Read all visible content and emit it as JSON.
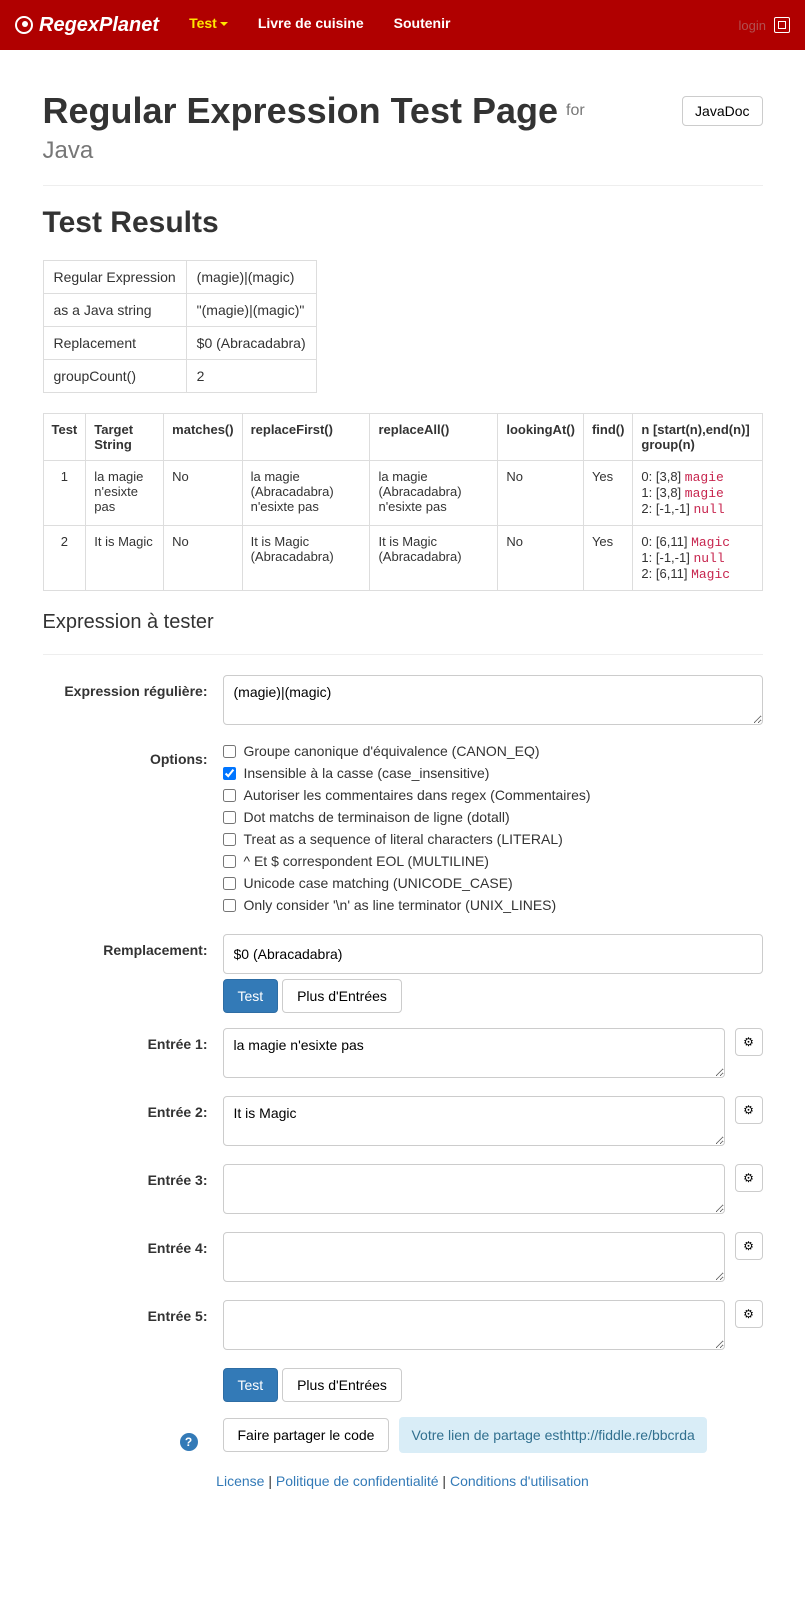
{
  "nav": {
    "brand": "RegexPlanet",
    "items": [
      {
        "label": "Test",
        "active": true
      },
      {
        "label": "Livre de cuisine",
        "active": false
      },
      {
        "label": "Soutenir",
        "active": false
      }
    ],
    "login": "login"
  },
  "header": {
    "title": "Regular Expression Test Page",
    "for": "for",
    "language": "Java",
    "javadoc_btn": "JavaDoc"
  },
  "results": {
    "title": "Test Results",
    "summary": [
      {
        "label": "Regular Expression",
        "value": "(magie)|(magic)"
      },
      {
        "label": "as a Java string",
        "value": "\"(magie)|(magic)\""
      },
      {
        "label": "Replacement",
        "value": "$0 (Abracadabra)"
      },
      {
        "label": "groupCount()",
        "value": "2"
      }
    ],
    "columns": [
      "Test",
      "Target String",
      "matches()",
      "replaceFirst()",
      "replaceAll()",
      "lookingAt()",
      "find()",
      "n [start(n),end(n)] group(n)"
    ],
    "rows": [
      {
        "test": "1",
        "target": "la magie n'esixte pas",
        "matches": "No",
        "replaceFirst": "la magie (Abracadabra) n'esixte pas",
        "replaceAll": "la magie (Abracadabra) n'esixte pas",
        "lookingAt": "No",
        "find": "Yes",
        "groups": [
          {
            "prefix": "0: [3,8]",
            "val": "magie"
          },
          {
            "prefix": "1: [3,8]",
            "val": "magie"
          },
          {
            "prefix": "2: [-1,-1]",
            "val": "null"
          }
        ]
      },
      {
        "test": "2",
        "target": "It is Magic",
        "matches": "No",
        "replaceFirst": "It is Magic (Abracadabra)",
        "replaceAll": "It is Magic (Abracadabra)",
        "lookingAt": "No",
        "find": "Yes",
        "groups": [
          {
            "prefix": "0: [6,11]",
            "val": "Magic"
          },
          {
            "prefix": "1: [-1,-1]",
            "val": "null"
          },
          {
            "prefix": "2: [6,11]",
            "val": "Magic"
          }
        ]
      }
    ]
  },
  "form": {
    "title": "Expression à tester",
    "labels": {
      "regex": "Expression régulière:",
      "options": "Options:",
      "replacement": "Remplacement:",
      "input_prefix": "Entrée"
    },
    "regex_value": "(magie)|(magic)",
    "options": [
      {
        "label": "Groupe canonique d'équivalence (CANON_EQ)",
        "checked": false
      },
      {
        "label": "Insensible à la casse (case_insensitive)",
        "checked": true
      },
      {
        "label": "Autoriser les commentaires dans regex (Commentaires)",
        "checked": false
      },
      {
        "label": "Dot matchs de terminaison de ligne (dotall)",
        "checked": false
      },
      {
        "label": "Treat as a sequence of literal characters (LITERAL)",
        "checked": false
      },
      {
        "label": "^ Et $ correspondent EOL (MULTILINE)",
        "checked": false
      },
      {
        "label": "Unicode case matching (UNICODE_CASE)",
        "checked": false
      },
      {
        "label": "Only consider '\\n' as line terminator (UNIX_LINES)",
        "checked": false
      }
    ],
    "replacement_value": "$0 (Abracadabra)",
    "test_btn": "Test",
    "more_btn": "Plus d'Entrées",
    "inputs": [
      "la magie n'esixte pas",
      "It is Magic",
      "",
      "",
      ""
    ],
    "share_btn": "Faire partager le code",
    "share_msg": "Votre lien de partage est",
    "share_url": "http://fiddle.re/bbcrda"
  },
  "footer": {
    "links": [
      "License",
      "Politique de confidentialité",
      "Conditions d'utilisation"
    ],
    "sep": " | "
  }
}
